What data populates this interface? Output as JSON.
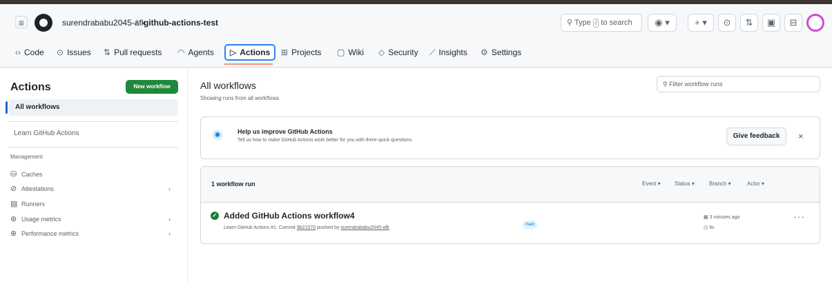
{
  "header": {
    "owner": "surendrababu2045-afk",
    "separator": "/",
    "repo": "github-actions-test",
    "search_prefix": "Type",
    "search_key": "/",
    "search_suffix": "to search",
    "copilot_chevron": "▾",
    "plus_chevron": "+ ▾"
  },
  "tabs": [
    {
      "icon": "‹›",
      "label": "Code"
    },
    {
      "icon": "⊙",
      "label": "Issues"
    },
    {
      "icon": "⇅",
      "label": "Pull requests"
    },
    {
      "icon": "◠",
      "label": "Agents"
    },
    {
      "icon": "▷",
      "label": "Actions"
    },
    {
      "icon": "⊞",
      "label": "Projects"
    },
    {
      "icon": "▢",
      "label": "Wiki"
    },
    {
      "icon": "◇",
      "label": "Security"
    },
    {
      "icon": "⟋",
      "label": "Insights"
    },
    {
      "icon": "⚙",
      "label": "Settings"
    }
  ],
  "sidebar": {
    "title": "Actions",
    "new_workflow": "New workflow",
    "all_workflows": "All workflows",
    "learn": "Learn GitHub Actions",
    "management_label": "Management",
    "items": [
      {
        "label": "Caches",
        "icon": "database-icon",
        "glyph": "⛁",
        "chevron": ""
      },
      {
        "label": "Attestations",
        "icon": "shield-icon",
        "glyph": "⊘",
        "chevron": "›"
      },
      {
        "label": "Runners",
        "icon": "server-icon",
        "glyph": "▤",
        "chevron": ""
      },
      {
        "label": "Usage metrics",
        "icon": "graph-icon",
        "glyph": "⊛",
        "chevron": "›"
      },
      {
        "label": "Performance metrics",
        "icon": "pulse-icon",
        "glyph": "⊕",
        "chevron": "›"
      }
    ]
  },
  "main": {
    "title": "All workflows",
    "subtitle": "Showing runs from all workflows",
    "filter_placeholder": "Filter workflow runs",
    "banner": {
      "title": "Help us improve GitHub Actions",
      "desc": "Tell us how to make GitHub Actions work better for you with three quick questions.",
      "button": "Give feedback",
      "close": "×"
    },
    "runs": {
      "count": "1 workflow run",
      "filters": [
        "Event ▾",
        "Status ▾",
        "Branch ▾",
        "Actor ▾"
      ],
      "row": {
        "title": "Added GitHub Actions workflow4",
        "meta_prefix": "Learn GitHub Actions #1: Commit",
        "commit": "9b21570",
        "meta_mid": "pushed by",
        "actor": "surendrababu2045-afk",
        "branch": "main",
        "time": "3 minutes ago",
        "duration": "9s",
        "more": "···"
      }
    }
  },
  "colors": {
    "accent": "#0969da",
    "success": "#1a7f37",
    "new_workflow_bg": "#1f883d"
  }
}
